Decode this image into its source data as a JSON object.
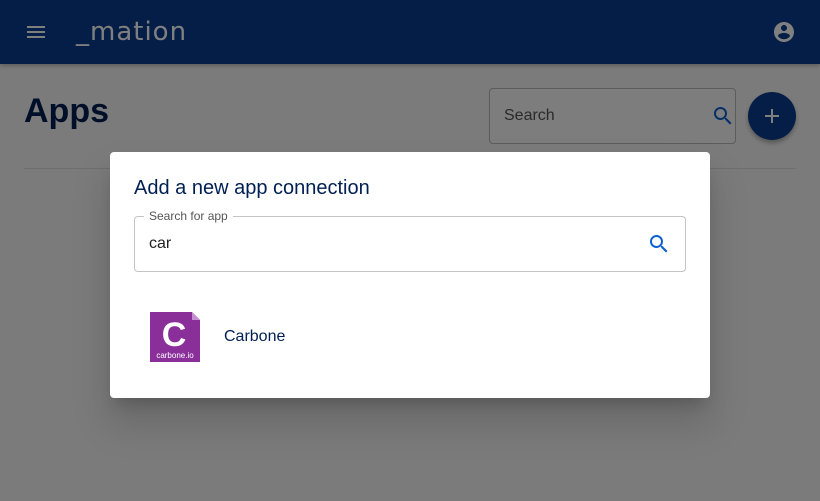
{
  "topbar": {
    "logo_text": "_mation",
    "menu_icon": "menu-icon",
    "account_icon": "account-circle-icon"
  },
  "page": {
    "title": "Apps",
    "search_placeholder": "Search",
    "search_icon": "search-icon",
    "add_icon": "plus-icon"
  },
  "dialog": {
    "title": "Add a new app connection",
    "search_label": "Search for app",
    "search_value": "car",
    "search_icon": "search-icon",
    "results": [
      {
        "name": "Carbone",
        "logo_letter": "C",
        "logo_caption": "carbone.io"
      }
    ]
  },
  "colors": {
    "primary": "#0b3d91",
    "heading": "#001f52",
    "carbone_brand": "#8a2f9a"
  }
}
